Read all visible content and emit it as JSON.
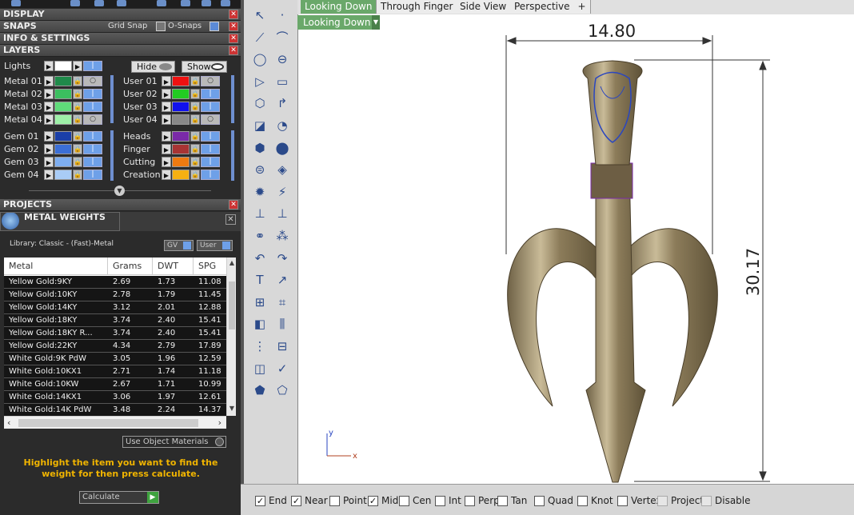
{
  "panel": {
    "sections": {
      "display": "DISPLAY",
      "snaps": "SNAPS",
      "grid_snap": "Grid Snap",
      "o_snaps": "O-Snaps",
      "info": "INFO & SETTINGS",
      "layers": "LAYERS",
      "projects": "PROJECTS"
    },
    "lights_label": "Lights",
    "hide_label": "Hide",
    "show_label": "Show",
    "layers_left": [
      {
        "label": "Metal 01",
        "color": "#1f8a4a"
      },
      {
        "label": "Metal 02",
        "color": "#3bbf5f"
      },
      {
        "label": "Metal 03",
        "color": "#5fdc7a"
      },
      {
        "label": "Metal 04",
        "color": "#9ef0a8"
      },
      {
        "label": "Gem 01",
        "color": "#1a3fa8"
      },
      {
        "label": "Gem 02",
        "color": "#3b6fd6"
      },
      {
        "label": "Gem 03",
        "color": "#7eaef0"
      },
      {
        "label": "Gem 04",
        "color": "#a9ccf6"
      }
    ],
    "layers_right": [
      {
        "label": "User 01",
        "color": "#ee1111"
      },
      {
        "label": "User 02",
        "color": "#22cc22"
      },
      {
        "label": "User 03",
        "color": "#1111ee"
      },
      {
        "label": "User 04",
        "color": "#888888"
      },
      {
        "label": "Heads",
        "color": "#7a2aa8"
      },
      {
        "label": "Finger",
        "color": "#a83434"
      },
      {
        "label": "Cutting",
        "color": "#ee7a11"
      },
      {
        "label": "Creation",
        "color": "#f6b012"
      }
    ],
    "metal_weights": {
      "title": "METAL WEIGHTS",
      "library": "Library: Classic - (Fast)-Metal",
      "gv": "GV",
      "user": "User",
      "columns": [
        "Metal",
        "Grams",
        "DWT",
        "SPG"
      ],
      "rows": [
        [
          "Yellow Gold:9KY",
          "2.69",
          "1.73",
          "11.08"
        ],
        [
          "Yellow Gold:10KY",
          "2.78",
          "1.79",
          "11.45"
        ],
        [
          "Yellow Gold:14KY",
          "3.12",
          "2.01",
          "12.88"
        ],
        [
          "Yellow Gold:18KY",
          "3.74",
          "2.40",
          "15.41"
        ],
        [
          "Yellow Gold:18KY R...",
          "3.74",
          "2.40",
          "15.41"
        ],
        [
          "Yellow Gold:22KY",
          "4.34",
          "2.79",
          "17.89"
        ],
        [
          "White Gold:9K PdW",
          "3.05",
          "1.96",
          "12.59"
        ],
        [
          "White Gold:10KX1",
          "2.71",
          "1.74",
          "11.18"
        ],
        [
          "White Gold:10KW",
          "2.67",
          "1.71",
          "10.99"
        ],
        [
          "White Gold:14KX1",
          "3.06",
          "1.97",
          "12.61"
        ],
        [
          "White Gold:14K PdW",
          "3.48",
          "2.24",
          "14.37"
        ]
      ],
      "use_object_materials": "Use Object Materials",
      "hint": "Highlight the item you want to find the weight for then press calculate.",
      "calculate": "Calculate"
    }
  },
  "tabs": [
    "Looking Down",
    "Through Finger",
    "Side View",
    "Perspective",
    "+"
  ],
  "viewport": {
    "label": "Looking Down",
    "width_dim": "14.80",
    "height_dim": "30.17",
    "axis_y": "y",
    "axis_x": "x"
  },
  "snaps": [
    {
      "label": "End",
      "checked": true
    },
    {
      "label": "Near",
      "checked": true
    },
    {
      "label": "Point",
      "checked": false
    },
    {
      "label": "Mid",
      "checked": true
    },
    {
      "label": "Cen",
      "checked": false
    },
    {
      "label": "Int",
      "checked": false
    },
    {
      "label": "Perp",
      "checked": false
    },
    {
      "label": "Tan",
      "checked": false
    },
    {
      "label": "Quad",
      "checked": false
    },
    {
      "label": "Knot",
      "checked": false
    },
    {
      "label": "Vertex",
      "checked": false
    },
    {
      "label": "Project",
      "checked": false,
      "disabled": true
    },
    {
      "label": "Disable",
      "checked": false,
      "disabled": true
    }
  ]
}
